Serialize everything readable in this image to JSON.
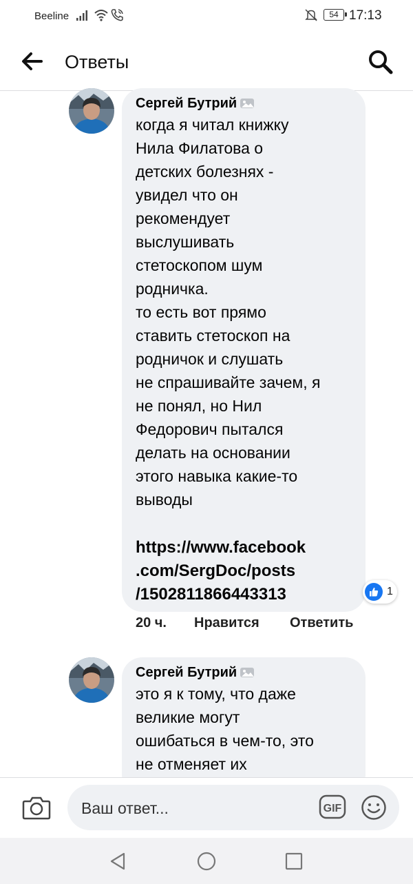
{
  "status_bar": {
    "carrier": "Beeline",
    "battery": "54",
    "time": "17:13"
  },
  "header": {
    "title": "Ответы"
  },
  "comments": [
    {
      "author": "Сергей Бутрий",
      "text": "когда я читал книжку\nНила Филатова о\nдетских болезнях -\nувидел что он\nрекомендует\nвыслушивать\nстетоскопом шум\nродничка.\nто есть вот прямо\nставить стетоскоп на\nродничок и слушать\nне спрашивайте зачем, я\nне понял, но Нил\nФедорович пытался\nделать на основании\nэтого навыка какие-то\nвыводы",
      "link": "https://www.facebook\n.com/SergDoc/posts\n/1502811866443313",
      "reaction_count": "1",
      "time": "20 ч.",
      "like_label": "Нравится",
      "reply_label": "Ответить"
    },
    {
      "author": "Сергей Бутрий",
      "text": "это я к тому, что даже\nвеликие могут\nошибаться в чем-то, это\nне отменяет их"
    }
  ],
  "composer": {
    "placeholder": "Ваш ответ...",
    "gif_label": "GIF"
  },
  "colors": {
    "accent": "#1877f2",
    "bubble": "#eff1f4"
  }
}
